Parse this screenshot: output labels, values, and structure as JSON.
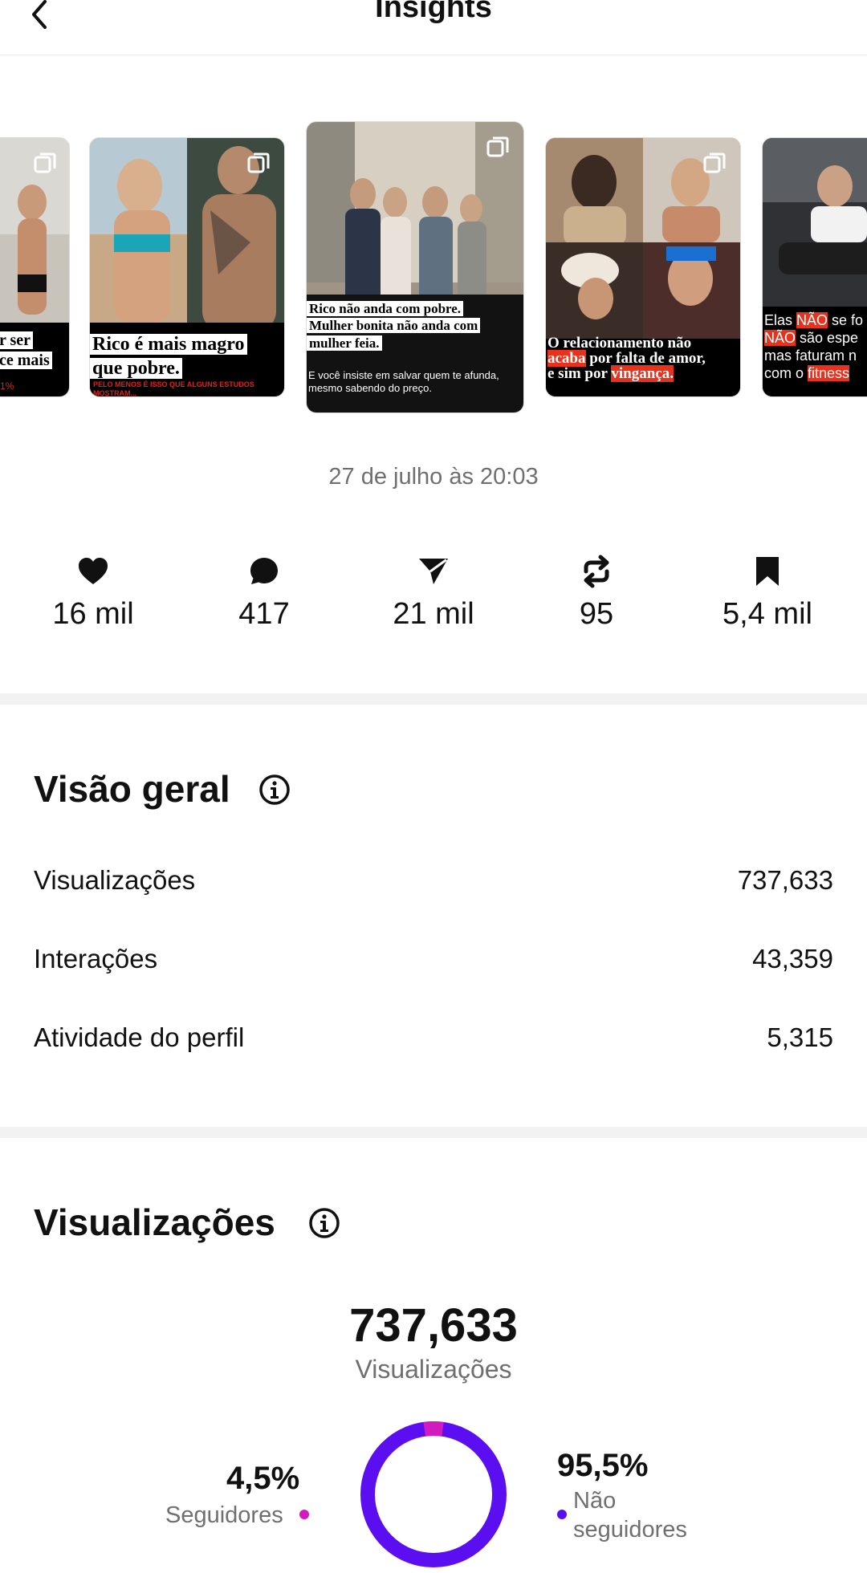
{
  "header": {
    "title": "Insights"
  },
  "carousel": {
    "cards": [
      {
        "lines": [
          "r ser",
          "ce mais"
        ],
        "small": "1%"
      },
      {
        "lines": [
          "Rico é mais magro",
          "que pobre."
        ],
        "small": "PELO MENOS É ISSO QUE ALGUNS ESTUDOS MOSTRAM..."
      },
      {
        "lines": [
          "Rico não anda com pobre.",
          "Mulher bonita não anda com",
          "mulher feia."
        ],
        "small": "E você insiste em salvar quem te afunda, mesmo sabendo do preço."
      },
      {
        "line1_a": "O relacionamento não",
        "line2_hl": "acaba",
        "line2_b": " por falta de amor,",
        "line3_a": "e sim por ",
        "line3_hl": "vingança."
      },
      {
        "l1_a": "Elas ",
        "l1_hl": "NÃO",
        "l1_b": " se fo",
        "l2_hl": "NÃO",
        "l2_b": " são espe",
        "l3": "mas faturam n",
        "l4_a": "com o ",
        "l4_hl": "fitness"
      }
    ]
  },
  "date": "27 de julho às 20:03",
  "stats": [
    {
      "icon": "heart-icon",
      "value": "16 mil"
    },
    {
      "icon": "comment-icon",
      "value": "417"
    },
    {
      "icon": "share-icon",
      "value": "21 mil"
    },
    {
      "icon": "repost-icon",
      "value": "95"
    },
    {
      "icon": "bookmark-icon",
      "value": "5,4 mil"
    }
  ],
  "overview": {
    "title": "Visão geral",
    "rows": [
      {
        "label": "Visualizações",
        "value": "737,633"
      },
      {
        "label": "Interações",
        "value": "43,359"
      },
      {
        "label": "Atividade do perfil",
        "value": "5,315"
      }
    ]
  },
  "views": {
    "title": "Visualizações",
    "total": "737,633",
    "total_label": "Visualizações",
    "followers_pct": "4,5%",
    "followers_label": "Seguidores",
    "non_followers_pct": "95,5%",
    "non_followers_label_1": "Não",
    "non_followers_label_2": "seguidores",
    "followers_fraction": 0.045,
    "colors": {
      "followers": "#d21bbf",
      "non_followers": "#5b0ff0"
    }
  }
}
